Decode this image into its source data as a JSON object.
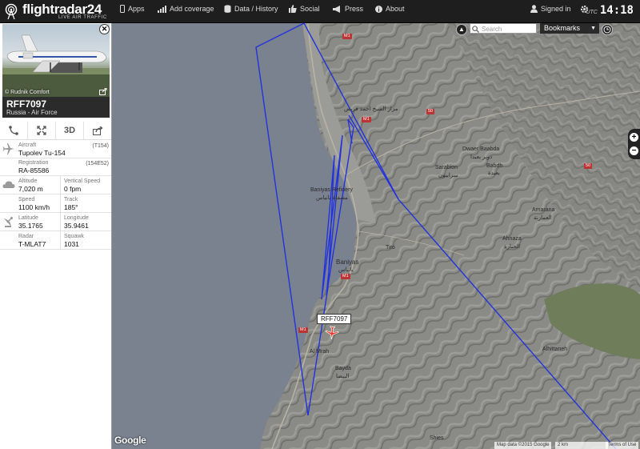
{
  "app": {
    "name": "flightradar24",
    "tagline": "LIVE AIR TRAFFIC"
  },
  "nav": {
    "apps": "Apps",
    "add_coverage": "Add coverage",
    "data_history": "Data / History",
    "social": "Social",
    "press": "Press",
    "about": "About",
    "signed_in": "Signed in",
    "utc_label": "UTC",
    "utc_time": "14:18"
  },
  "flight": {
    "photo_credit": "© Rudnik Comfort",
    "callsign": "RFF7097",
    "operator": "Russia - Air Force",
    "actions": [
      "route-icon",
      "expand-icon",
      "3D",
      "share-icon"
    ],
    "aircraft_label": "Aircraft",
    "aircraft_value": "Tupolev Tu-154",
    "aircraft_code": "(T154)",
    "registration_label": "Registration",
    "registration_value": "RA-85586",
    "registration_code": "(154E52)",
    "altitude_label": "Altitude",
    "altitude_value": "7,020 m",
    "vspeed_label": "Vertical Speed",
    "vspeed_value": "0 fpm",
    "speed_label": "Speed",
    "speed_value": "1100 km/h",
    "track_label": "Track",
    "track_value": "185°",
    "latitude_label": "Latitude",
    "latitude_value": "35.1765",
    "longitude_label": "Longitude",
    "longitude_value": "35.9461",
    "radar_label": "Radar",
    "radar_value": "T-MLAT7",
    "squawk_label": "Squawk",
    "squawk_value": "1031"
  },
  "map": {
    "search_placeholder": "Search",
    "bookmarks": "Bookmarks",
    "flight_label": "RFF7097",
    "places": {
      "dwaer": "Dwaer Baabda",
      "dwaer_ar": "دوير بعبدا",
      "sarabion": "Sarabion",
      "sarabion_ar": "سرابيون",
      "babdh": "Babdh",
      "babdh_ar": "بعبدة",
      "amarana": "Amarana",
      "amarana_ar": "العمارنة",
      "baniyas_refinery": "Baniyas Refinery",
      "baniyas_refinery_ar": "مصفاة بانياس",
      "ahnaza": "Ahnaza",
      "ahnaza_ar": "الحنازة",
      "tiro": "Tiro",
      "baniyas": "Baniyas",
      "baniyas_ar": "بانياس",
      "al_mrah": "Al Mrah",
      "bayda": "Bayda",
      "bayda_ar": "البيضا",
      "alhittaneh": "Alhittaneh",
      "shies": "Shies",
      "mazar": "مزار الشيخ احمد فريض"
    },
    "road_m1": "M1",
    "road_50": "50",
    "footer_data": "Map data ©2015 Google",
    "footer_scale": "2 km",
    "footer_terms": "Terms of Use",
    "google": "Google"
  },
  "colors": {
    "track": "#2233dd",
    "topbar": "#1e1e1e",
    "sea": "#7a8290"
  }
}
